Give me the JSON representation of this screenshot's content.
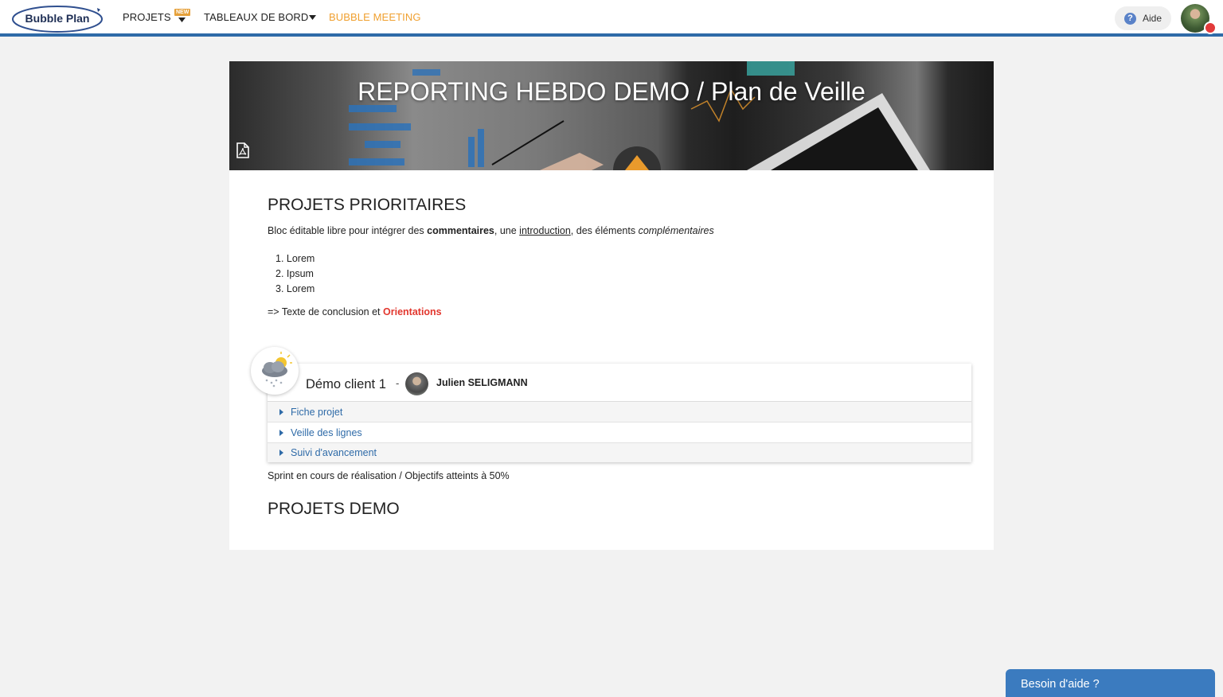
{
  "nav": {
    "logo_text": "Bubble Plan",
    "projets": "PROJETS",
    "new_badge": "NEW",
    "tableaux": "TABLEAUX DE BORD",
    "bubble_meeting": "BUBBLE MEETING",
    "help": "Aide"
  },
  "banner": {
    "title": "REPORTING HEBDO DEMO / Plan de Veille"
  },
  "section1": {
    "title": "PROJETS PRIORITAIRES",
    "intro": {
      "p1": "Bloc éditable libre pour intégrer des ",
      "bold": "commentaires",
      "p2": ", une ",
      "underline": "introduction",
      "p3": ", des éléments ",
      "italic": "complémentaires"
    },
    "list": [
      "1. Lorem",
      "2. Ipsum",
      "3. Lorem"
    ],
    "conclusion_prefix": "=> Texte de conclusion et ",
    "conclusion_highlight": "Orientations"
  },
  "project": {
    "name": "Démo client 1",
    "dash": "-",
    "owner": "Julien SELIGMANN",
    "rows": [
      "Fiche projet",
      "Veille des lignes",
      "Suivi d'avancement"
    ],
    "status": "Sprint en cours de réalisation / Objectifs atteints à 50%"
  },
  "section2": {
    "title": "PROJETS DEMO"
  },
  "chat": {
    "label": "Besoin d'aide ?"
  },
  "colors": {
    "brand_blue": "#2f6ba8",
    "accent_orange": "#f0a030",
    "highlight_red": "#e2372e"
  }
}
